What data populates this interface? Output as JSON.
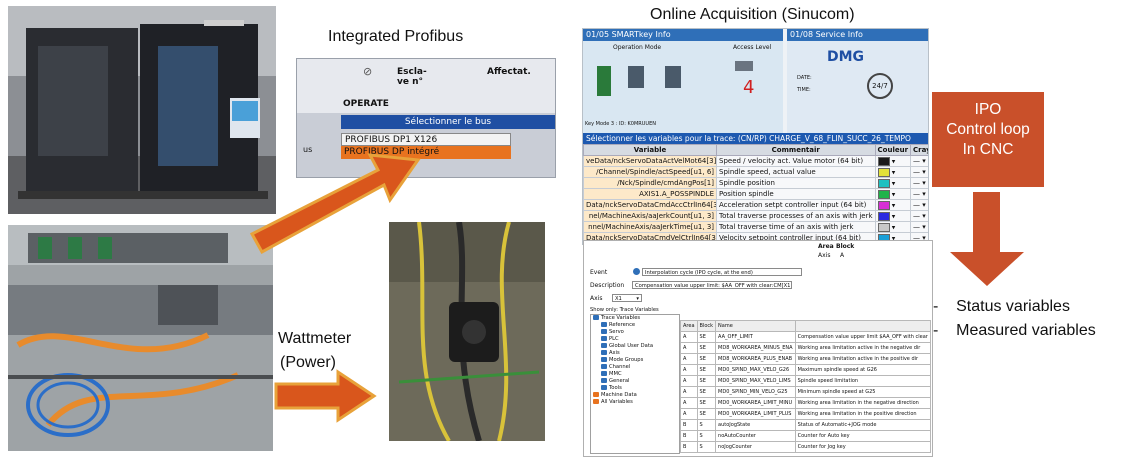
{
  "captions": {
    "integrated_profibus": "Integrated Profibus",
    "online_acquisition": "Online Acquisition (Sinucom)",
    "wattmeter_line1": "Wattmeter",
    "wattmeter_line2": "(Power)"
  },
  "profibus_hmi": {
    "operate": "OPERATE",
    "col_esclave": "Escla-\nve n°",
    "col_affectat": "Affectat.",
    "dialog_title": "Sélectionner le bus",
    "options": [
      "PROFIBUS DP1 X126",
      "PROFIBUS DP intégré"
    ],
    "selected_option": "PROFIBUS DP intégré"
  },
  "sinucom": {
    "header_left": "01/05    SMARTkey Info",
    "header_right": "01/08    Service Info",
    "operation_mode": "Operation Mode",
    "access_level_label": "Access Level",
    "access_level_value": "4",
    "brand": "DMG",
    "date_label": "DATE:",
    "time_label": "TIME:",
    "keymode": "Key Mode 3 : ID: K0MRUUEN",
    "trace_title": "Sélectionner les variables pour la trace: (CN/RP) CHARGE_V_68_FLIN_SUCC_26_TEMPO",
    "columns": [
      "Variable",
      "Commentair",
      "Couleur",
      "Crayon"
    ],
    "rows": [
      {
        "variable": "veData/nckServoDataActVelMot64[3]",
        "comment": "Speed / velocity act. Value motor (64 bit)",
        "color": "#1a1a1a"
      },
      {
        "variable": "/Channel/Spindle/actSpeed[u1, 6]",
        "comment": "Spindle speed, actual value",
        "color": "#e2e23a"
      },
      {
        "variable": "/Nck/Spindle/cmdAngPos[1]",
        "comment": "Spindle position",
        "color": "#1fc0c0"
      },
      {
        "variable": "AXIS1.A_POSSPINDLE",
        "comment": "Position spindle",
        "color": "#1fb34a"
      },
      {
        "variable": "Data/nckServoDataCmdAccCtrlIn64[3]",
        "comment": "Acceleration setpt controller input (64 bit)",
        "color": "#d62fd6"
      },
      {
        "variable": "nel/MachineAxis/aaJerkCount[u1, 3]",
        "comment": "Total traverse processes of an axis with jerk",
        "color": "#2a2ae0"
      },
      {
        "variable": "nnel/MachineAxis/aaJerkTime[u1, 3]",
        "comment": "Total traverse time of an axis with jerk",
        "color": "#c8c8c8"
      },
      {
        "variable": "Data/nckServoDataCmdVelCtrlIn64[3]",
        "comment": "Velocity setpoint controller input (64 bit)",
        "color": "#1aa0d8"
      }
    ]
  },
  "trace_dialog": {
    "area_label": "Area",
    "block_label": "Block",
    "area_value": "Axis",
    "block_value": "A",
    "event_label": "Event",
    "event_value": "Interpolation cycle (IPO cycle, at the end)",
    "description_label": "Description",
    "description_value": "Compensation value upper limit: $AA_OFF with clear:CM[X1]",
    "axis_label": "Axis",
    "axis_value": "X1",
    "show_only": "Show only: Trace Variables",
    "tree": [
      "Trace Variables",
      "Reference",
      "Servo",
      "PLC",
      "Global User Data",
      "Axis",
      "Mode Groups",
      "Channel",
      "MMC",
      "General",
      "Tools",
      "Machine Data",
      "All Variables"
    ],
    "columns": [
      "Area",
      "Block",
      "Name",
      ""
    ],
    "rows": [
      [
        "A",
        "SE",
        "AA_OFF_LIMIT",
        "Compensation value upper limit $AA_OFF with clear"
      ],
      [
        "A",
        "SE",
        "MD8_WORKAREA_MINUS_ENA",
        "Working area limitation active in the negative dir"
      ],
      [
        "A",
        "SE",
        "MD8_WORKAREA_PLUS_ENAB",
        "Working area limitation active in the positive dir"
      ],
      [
        "A",
        "SE",
        "MD0_SPIND_MAX_VELO_G26",
        "Maximum spindle speed at G26"
      ],
      [
        "A",
        "SE",
        "MD0_SPIND_MAX_VELO_LIMS",
        "Spindle speed limitation"
      ],
      [
        "A",
        "SE",
        "MD0_SPIND_MIN_VELO_G25",
        "Minimum spindle speed at G25"
      ],
      [
        "A",
        "SE",
        "MD0_WORKAREA_LIMIT_MINU",
        "Working area limitation in the negative direction"
      ],
      [
        "A",
        "SE",
        "MD0_WORKAREA_LIMIT_PLUS",
        "Working area limitation in the positive direction"
      ],
      [
        "B",
        "S",
        "autoJogState",
        "Status of Automatic+JOG mode"
      ],
      [
        "B",
        "S",
        "noAutoCounter",
        "Counter for Auto key"
      ],
      [
        "B",
        "S",
        "noJogCounter",
        "Counter for Jog key"
      ]
    ]
  },
  "ipo_box": {
    "lines": [
      "IPO",
      "Control loop",
      "In CNC"
    ],
    "color": "#c9502a"
  },
  "bullets": [
    "Status variables",
    "Measured variables"
  ],
  "arrow_colors": {
    "fill": "#d9561c",
    "outline": "#e8a23a"
  }
}
